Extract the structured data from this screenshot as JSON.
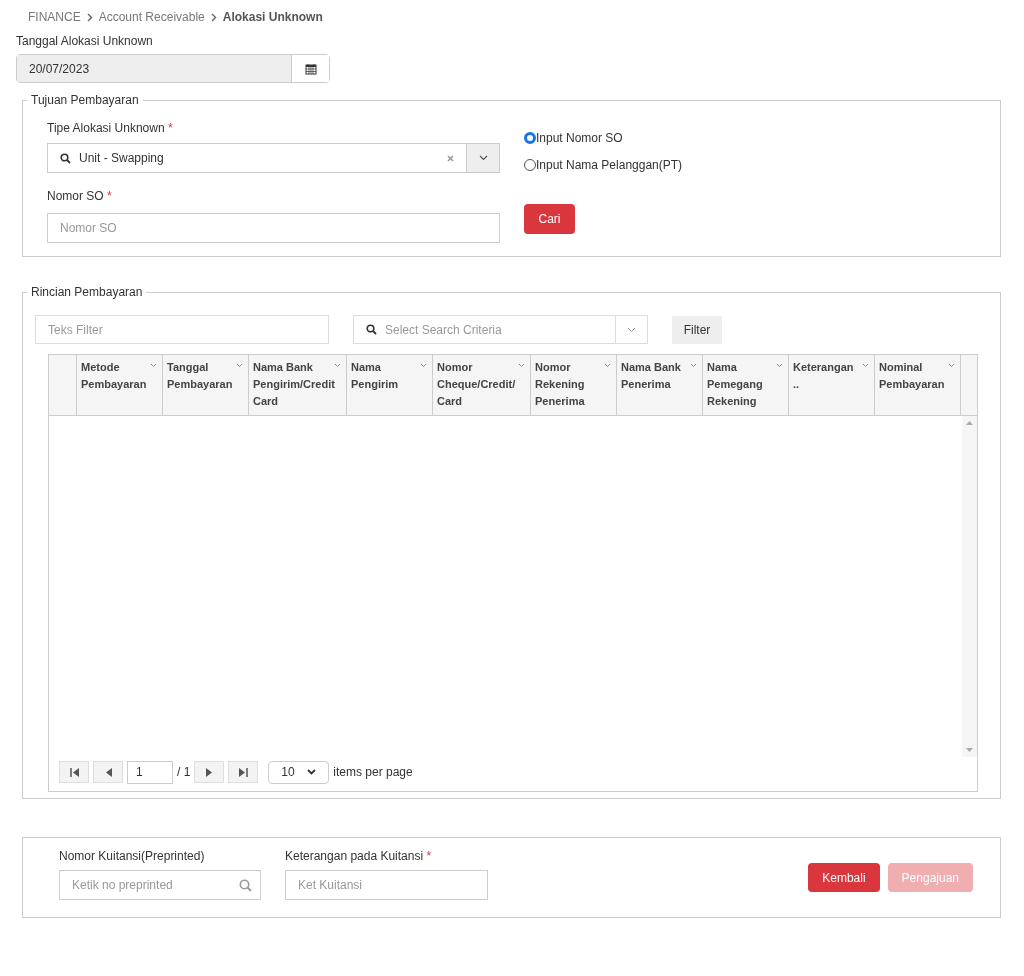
{
  "breadcrumb": [
    {
      "label": "FINANCE",
      "current": false
    },
    {
      "label": "Account Receivable",
      "current": false
    },
    {
      "label": "Alokasi Unknown",
      "current": true
    }
  ],
  "date_field": {
    "label": "Tanggal Alokasi Unknown",
    "value": "20/07/2023"
  },
  "tujuan": {
    "legend": "Tujuan Pembayaran",
    "type_label": "Tipe Alokasi Unknown",
    "type_required": "*",
    "so_required": "*",
    "type_value": "Unit - Swapping",
    "so_label": "Nomor SO",
    "so_placeholder": "Nomor SO",
    "search_button": "Cari",
    "options": [
      {
        "label": "Input Nomor SO",
        "selected": true
      },
      {
        "label": "Input Nama Pelanggan(PT)",
        "selected": false
      }
    ]
  },
  "rincian": {
    "legend": "Rincian Pembayaran",
    "filter_placeholder": "Teks Filter",
    "criteria_placeholder": "Select Search Criteria",
    "filter_button": "Filter",
    "columns": [
      "Metode Pembayaran",
      "Tanggal Pembayaran",
      "Nama Bank Pengirim/Credit Card",
      "Nama Pengirim",
      "Nomor Cheque/Credit/ Card",
      "Nomor Rekening Penerima",
      "Nama Bank Penerima",
      "Nama Pemegang Rekening",
      "Keterangan ..",
      "Nominal Pembayaran"
    ],
    "pager": {
      "page": "1",
      "total": "/ 1",
      "per_page": "10",
      "per_page_label": "items per page"
    }
  },
  "kuitansi": {
    "nomor_label": "Nomor Kuitansi(Preprinted)",
    "nomor_placeholder": "Ketik no preprinted",
    "ket_label": "Keterangan pada Kuitansi",
    "ket_required": "*",
    "ket_placeholder": "Ket Kuitansi",
    "buttons": [
      {
        "label": "Kembali",
        "disabled": false
      },
      {
        "label": "Pengajuan",
        "disabled": true
      }
    ]
  }
}
